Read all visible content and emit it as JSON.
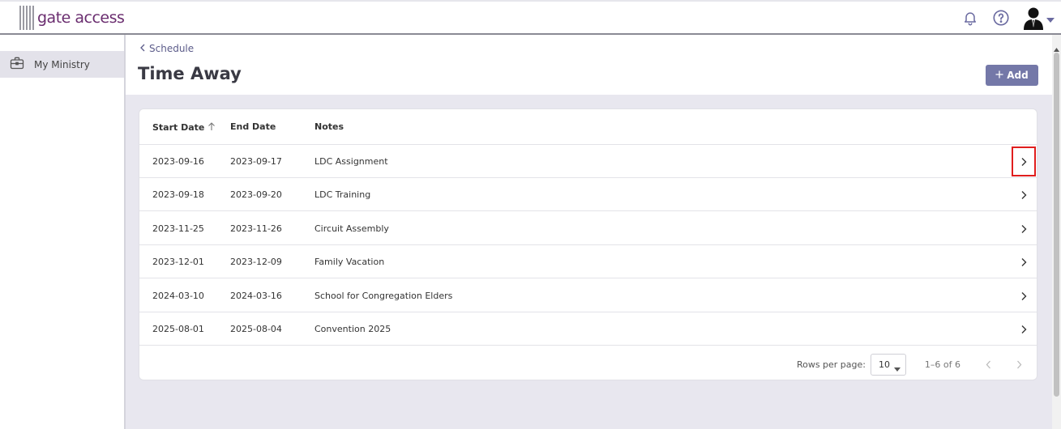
{
  "app": {
    "logo_text": "gate access"
  },
  "header": {
    "icons": [
      "bell-icon",
      "help-icon",
      "user-avatar-icon",
      "caret-down-icon"
    ]
  },
  "sidebar": {
    "items": [
      {
        "label": "My Ministry",
        "icon": "briefcase-icon"
      }
    ]
  },
  "page": {
    "breadcrumb": "Schedule",
    "title": "Time Away",
    "add_label": "Add"
  },
  "table": {
    "columns": [
      "Start Date",
      "End Date",
      "Notes"
    ],
    "sort_column": "Start Date",
    "rows": [
      {
        "start": "2023-09-16",
        "end": "2023-09-17",
        "notes": "LDC Assignment"
      },
      {
        "start": "2023-09-18",
        "end": "2023-09-20",
        "notes": "LDC Training"
      },
      {
        "start": "2023-11-25",
        "end": "2023-11-26",
        "notes": "Circuit Assembly"
      },
      {
        "start": "2023-12-01",
        "end": "2023-12-09",
        "notes": "Family Vacation"
      },
      {
        "start": "2024-03-10",
        "end": "2024-03-16",
        "notes": "School for Congregation Elders"
      },
      {
        "start": "2025-08-01",
        "end": "2025-08-04",
        "notes": "Convention 2025"
      }
    ]
  },
  "pagination": {
    "rows_per_page_label": "Rows per page:",
    "rows_per_page_value": "10",
    "range": "1–6 of 6"
  },
  "colors": {
    "accent": "#7478a8",
    "logo": "#6a2d6f",
    "highlight": "#e01e1e"
  }
}
